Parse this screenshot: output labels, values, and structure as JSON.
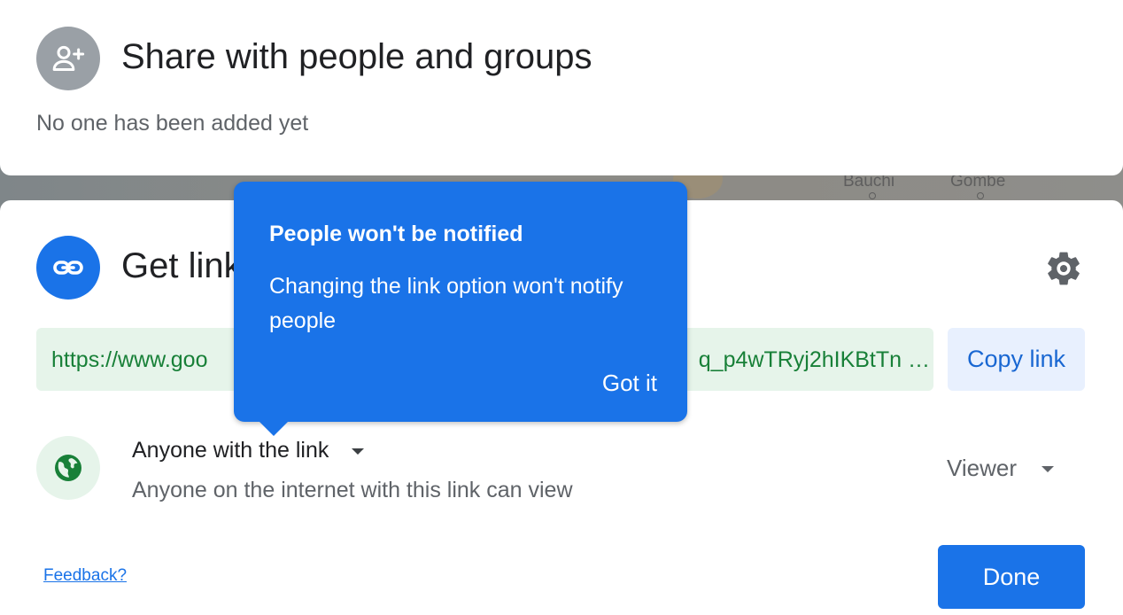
{
  "backdrop": {
    "map_labels": [
      "Bauchi",
      "Gombe"
    ]
  },
  "share": {
    "title": "Share with people and groups",
    "subtitle": "No one has been added yet",
    "icon": "person-add-icon"
  },
  "get_link": {
    "title": "Get link",
    "icon": "link-icon",
    "settings_icon": "gear-icon",
    "url_start": "https://www.goo",
    "url_end": "q_p4wTRyj2hIKBtTn …",
    "copy_label": "Copy link",
    "access": {
      "label": "Anyone with the link",
      "description": "Anyone on the internet with this link can view",
      "icon": "globe-icon"
    },
    "role": "Viewer"
  },
  "tooltip": {
    "title": "People won't be notified",
    "body": "Changing the link option won't notify people",
    "button": "Got it"
  },
  "footer": {
    "feedback": "Feedback?",
    "done": "Done"
  },
  "colors": {
    "primary": "#1a73e8",
    "link_green": "#188038",
    "link_bg": "#e6f4ea",
    "copy_bg": "#e8f0fe",
    "avatar_gray": "#9aa0a6"
  }
}
